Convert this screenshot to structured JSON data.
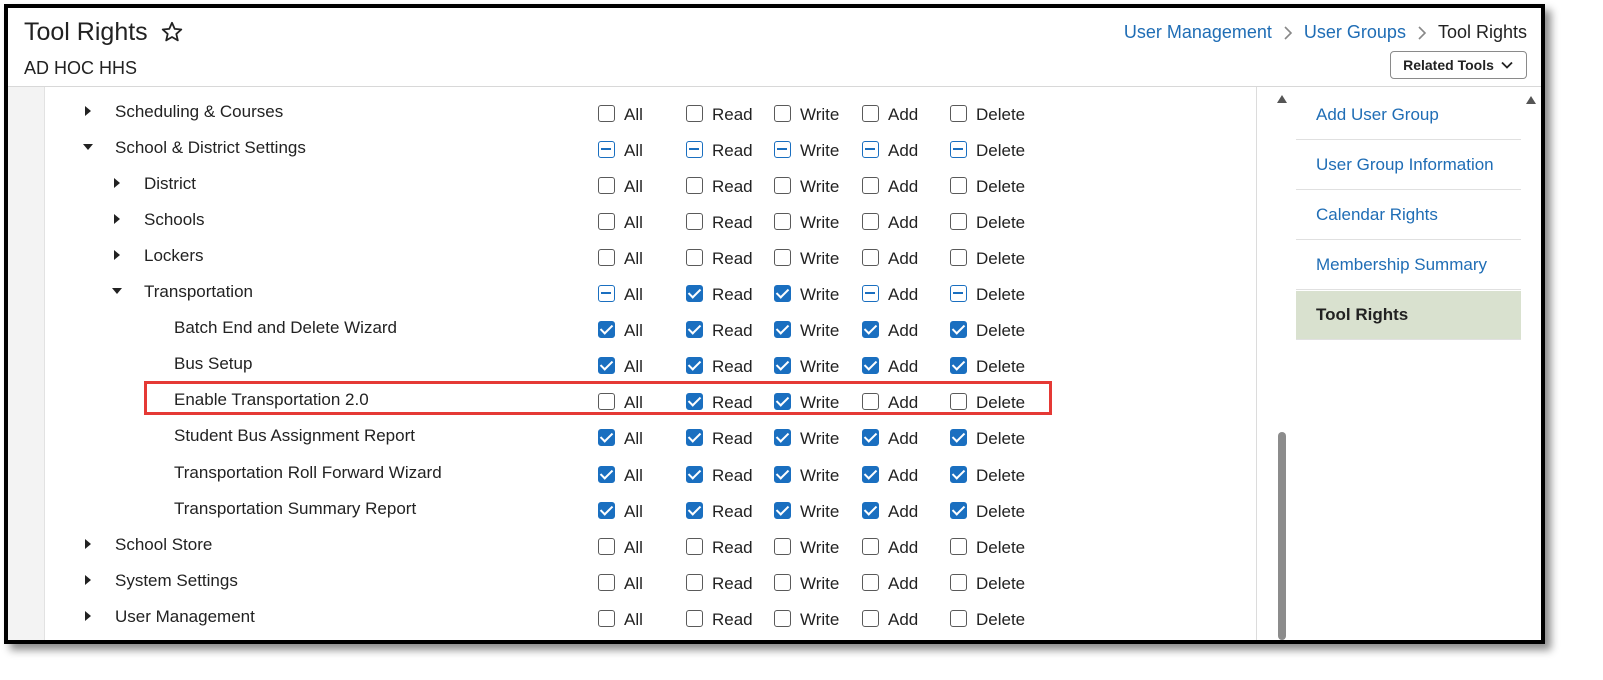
{
  "header": {
    "title": "Tool Rights",
    "subtitle": "AD HOC HHS",
    "breadcrumb": [
      "User Management",
      "User Groups"
    ],
    "breadcrumb_current": "Tool Rights",
    "related_tools_label": "Related Tools"
  },
  "permission_labels": [
    "All",
    "Read",
    "Write",
    "Add",
    "Delete"
  ],
  "tree_rows": [
    {
      "label": "Scheduling & Courses",
      "level": 0,
      "toggle": "collapsed",
      "perms": [
        "unchecked",
        "unchecked",
        "unchecked",
        "unchecked",
        "unchecked"
      ]
    },
    {
      "label": "School & District Settings",
      "level": 0,
      "toggle": "expanded",
      "perms": [
        "partial",
        "partial",
        "partial",
        "partial",
        "partial"
      ]
    },
    {
      "label": "District",
      "level": 1,
      "toggle": "collapsed",
      "perms": [
        "unchecked",
        "unchecked",
        "unchecked",
        "unchecked",
        "unchecked"
      ]
    },
    {
      "label": "Schools",
      "level": 1,
      "toggle": "collapsed",
      "perms": [
        "unchecked",
        "unchecked",
        "unchecked",
        "unchecked",
        "unchecked"
      ]
    },
    {
      "label": "Lockers",
      "level": 1,
      "toggle": "collapsed",
      "perms": [
        "unchecked",
        "unchecked",
        "unchecked",
        "unchecked",
        "unchecked"
      ]
    },
    {
      "label": "Transportation",
      "level": 1,
      "toggle": "expanded",
      "perms": [
        "partial",
        "checked",
        "checked",
        "partial",
        "partial"
      ]
    },
    {
      "label": "Batch End and Delete Wizard",
      "level": 2,
      "toggle": "none",
      "perms": [
        "checked",
        "checked",
        "checked",
        "checked",
        "checked"
      ]
    },
    {
      "label": "Bus Setup",
      "level": 2,
      "toggle": "none",
      "perms": [
        "checked",
        "checked",
        "checked",
        "checked",
        "checked"
      ]
    },
    {
      "label": "Enable Transportation 2.0",
      "level": 2,
      "toggle": "none",
      "highlighted": true,
      "perms": [
        "unchecked",
        "checked",
        "checked",
        "unchecked",
        "unchecked"
      ]
    },
    {
      "label": "Student Bus Assignment Report",
      "level": 2,
      "toggle": "none",
      "perms": [
        "checked",
        "checked",
        "checked",
        "checked",
        "checked"
      ]
    },
    {
      "label": "Transportation Roll Forward Wizard",
      "level": 2,
      "toggle": "none",
      "perms": [
        "checked",
        "checked",
        "checked",
        "checked",
        "checked"
      ]
    },
    {
      "label": "Transportation Summary Report",
      "level": 2,
      "toggle": "none",
      "perms": [
        "checked",
        "checked",
        "checked",
        "checked",
        "checked"
      ]
    },
    {
      "label": "School Store",
      "level": 0,
      "toggle": "collapsed",
      "perms": [
        "unchecked",
        "unchecked",
        "unchecked",
        "unchecked",
        "unchecked"
      ]
    },
    {
      "label": "System Settings",
      "level": 0,
      "toggle": "collapsed",
      "perms": [
        "unchecked",
        "unchecked",
        "unchecked",
        "unchecked",
        "unchecked"
      ]
    },
    {
      "label": "User Management",
      "level": 0,
      "toggle": "collapsed",
      "perms": [
        "unchecked",
        "unchecked",
        "unchecked",
        "unchecked",
        "unchecked"
      ]
    }
  ],
  "side_nav": [
    {
      "label": "Add User Group",
      "active": false
    },
    {
      "label": "User Group Information",
      "active": false
    },
    {
      "label": "Calendar Rights",
      "active": false
    },
    {
      "label": "Membership Summary",
      "active": false
    },
    {
      "label": "Tool Rights",
      "active": true
    }
  ],
  "colors": {
    "link": "#1f6db5",
    "checkbox_checked": "#1a6fc0",
    "active_nav_bg": "#d9e1cf",
    "highlight_border": "#e53935"
  },
  "icons": {
    "favorite": "star-outline-icon",
    "breadcrumb_separator": "chevron-right-icon",
    "related_tools": "chevron-down-icon",
    "tree_collapsed": "triangle-right-icon",
    "tree_expanded": "triangle-down-icon"
  }
}
